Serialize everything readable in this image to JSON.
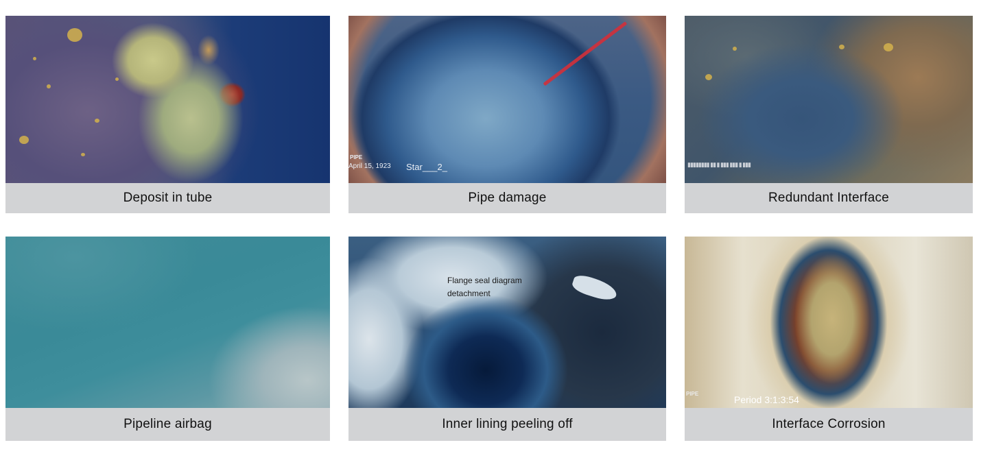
{
  "tiles": [
    {
      "caption": "Deposit in tube"
    },
    {
      "caption": "Pipe damage",
      "osd_brand": "PIPE",
      "osd_date": "April 15, 1923",
      "osd_label": "Star___2_"
    },
    {
      "caption": "Redundant  Interface",
      "osd_text": "▮▮▮▮▮▮▮▮ ▮▮ ▮ ▮▮▮ ▮▮▮ ▮ ▮▮▮"
    },
    {
      "caption": "Pipeline  airbag"
    },
    {
      "caption": "Inner lining peeling off",
      "annotation_line1": "Flange seal diagram",
      "annotation_line2": "detachment"
    },
    {
      "caption": "Interface Corrosion",
      "osd_prefix": "PIPE",
      "osd_text": "Period 3:1:3:54"
    }
  ]
}
